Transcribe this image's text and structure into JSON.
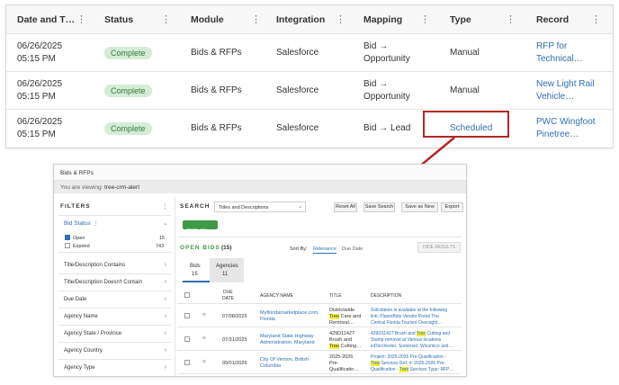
{
  "table": {
    "columns": [
      "Date and T…",
      "Status",
      "Module",
      "Integration",
      "Mapping",
      "Type",
      "Record"
    ],
    "rows": [
      {
        "date": "06/26/2025",
        "time": "05:15 PM",
        "status": "Complete",
        "module": "Bids & RFPs",
        "integration": "Salesforce",
        "mapping1": "Bid →",
        "mapping2": "Opportunity",
        "type": "Manual",
        "record1": "RFP for",
        "record2": "Technical…"
      },
      {
        "date": "06/26/2025",
        "time": "05:15 PM",
        "status": "Complete",
        "module": "Bids & RFPs",
        "integration": "Salesforce",
        "mapping1": "Bid →",
        "mapping2": "Opportunity",
        "type": "Manual",
        "record1": "New Light Rail",
        "record2": "Vehicle…"
      },
      {
        "date": "06/26/2025",
        "time": "05:15 PM",
        "status": "Complete",
        "module": "Bids & RFPs",
        "integration": "Salesforce",
        "mapping1": "Bid → Lead",
        "mapping2": "",
        "type": "Scheduled",
        "record1": "PWC Wingfoot",
        "record2": "Pinetree…"
      }
    ]
  },
  "inset": {
    "title": "Bids & RFPs",
    "viewing_label": "You are viewing:",
    "viewing_value": "tree-crm-alert",
    "filters_label": "FILTERS",
    "search_label": "SEARCH",
    "search_scope": "Titles and Descriptions",
    "buttons": {
      "reset": "Reset All",
      "save_search": "Save Search",
      "save_new": "Save as New",
      "export": "Export"
    },
    "tag": "TREE (15)",
    "bid_status_label": "Bid Status",
    "open_label": "Open",
    "open_count": "15",
    "expired_label": "Expired",
    "expired_count": "743",
    "filters": [
      "Title/Description Contains",
      "Title/Description Doesn't Contain",
      "Due Date",
      "Agency Name",
      "Agency State / Province",
      "Agency Country",
      "Agency Type"
    ],
    "open_bids_label": "OPEN BIDS",
    "open_bids_count": "(15)",
    "sort_by": "Sort By:",
    "sort_relevance": "Relevance",
    "sort_due_date": "Due Date",
    "hide_results": "HIDE RESULTS",
    "tab_bids": "Bids",
    "tab_bids_count": "15",
    "tab_agencies": "Agencies",
    "tab_agencies_count": "11",
    "col_due_1": "DUE",
    "col_due_2": "DATE",
    "col_agency": "AGENCY NAME",
    "col_title": "TITLE",
    "col_desc": "DESCRIPTION",
    "rows": [
      {
        "date": "07/08/2025",
        "agency1": "Myfloridamarketplace.com,",
        "agency2": "Florida",
        "t1": "Districtwide",
        "t2a": "Tree",
        "t2b": " Care and",
        "t3": "Removal…",
        "d1": "Solicitation is available at the following",
        "d2a": "link: PlanetBids Vendor Portal The",
        "d3": "Central Florida Tourism Oversight…"
      },
      {
        "date": "07/31/2025",
        "agency1": "Maryland State Highway",
        "agency2": "Administration, Maryland",
        "t1": "429D11427",
        "t2a": "Brush and",
        "t2b": "",
        "t3b": "Tree",
        "t3c": " Cutting…",
        "d1a": "429D11427 Brush and ",
        "d1b": "Tree",
        "d1c": " Cutting and",
        "d2a": "Stump removal at Various locations",
        "d3": "inDorchester, Somerset, Wicomico and…"
      },
      {
        "date": "09/01/2026",
        "agency1": "City Of Vernon, British",
        "agency2": "Columbia",
        "t1": "2025-2026",
        "t2a": "Pre-",
        "t3": "Qualificatio…",
        "d1": "Project: 2025-2026 Pre-Qualification -",
        "d2a": "Tree",
        "d2b": " Services Ref. #: 2025-2026 Pre-",
        "d3a": "Qualification - ",
        "d3b": "Tree",
        "d3c": " Services Type: RFP…"
      }
    ]
  },
  "colors": {
    "accent": "#b52626",
    "link": "#2f6fb5",
    "complete_bg": "#d5ecd6",
    "tag_green": "#3f9a45",
    "highlight": "#f6ee3a"
  }
}
